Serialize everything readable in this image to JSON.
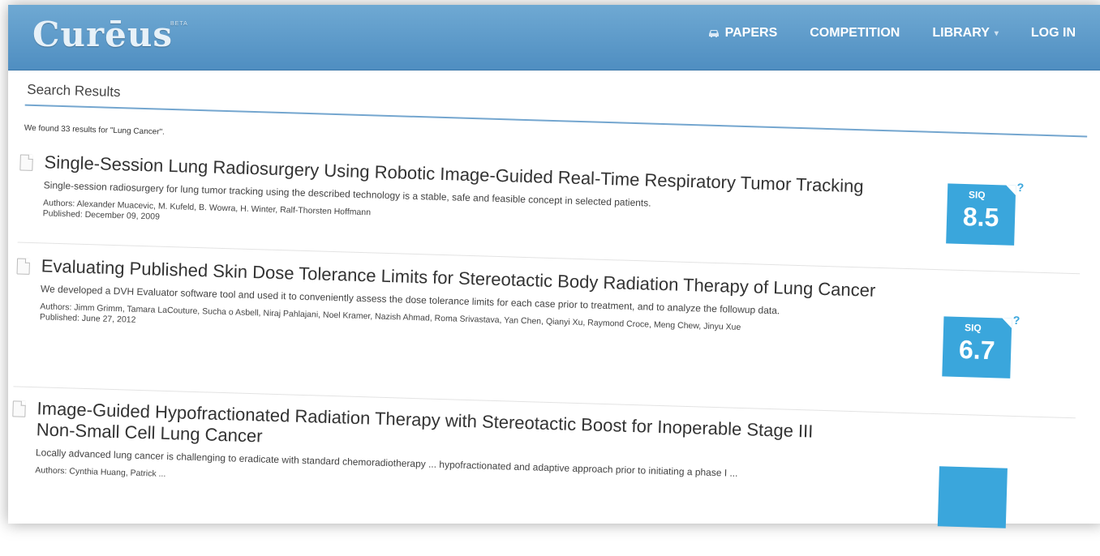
{
  "header": {
    "logo": "Curēus",
    "beta": "BETA",
    "nav": [
      {
        "label": "PAPERS",
        "icon": "car-icon"
      },
      {
        "label": "COMPETITION"
      },
      {
        "label": "LIBRARY",
        "dropdown": true
      },
      {
        "label": "LOG IN"
      }
    ]
  },
  "main": {
    "section_title": "Search Results",
    "found_text": "We found 33 results for \"Lung Cancer\".",
    "results": [
      {
        "title": "Single-Session Lung Radiosurgery Using Robotic Image-Guided Real-Time Respiratory Tumor Tracking",
        "summary": "Single-session radiosurgery for lung tumor tracking using the described technology is a stable, safe and feasible concept in selected patients.",
        "authors": "Authors: Alexander Muacevic, M. Kufeld, B. Wowra, H. Winter, Ralf-Thorsten Hoffmann",
        "published": "Published: December 09, 2009",
        "siq_label": "SIQ",
        "siq_score": "8.5"
      },
      {
        "title": "Evaluating Published Skin Dose Tolerance Limits for Stereotactic Body Radiation Therapy of Lung Cancer",
        "summary": "We developed a DVH Evaluator software tool and used it to conveniently assess the dose tolerance limits for each case prior to treatment, and to analyze the followup data.",
        "authors": "Authors: Jimm Grimm, Tamara LaCouture, Sucha o Asbell, Niraj Pahlajani, Noel Kramer, Nazish Ahmad, Roma Srivastava, Yan Chen, Qianyi Xu, Raymond Croce, Meng Chew, Jinyu Xue",
        "published": "Published: June 27, 2012",
        "siq_label": "SIQ",
        "siq_score": "6.7"
      },
      {
        "title": "Image-Guided Hypofractionated Radiation Therapy with Stereotactic Boost for Inoperable Stage III Non-Small Cell Lung Cancer",
        "summary": "Locally advanced lung cancer is challenging to eradicate with standard chemoradiotherapy ... hypofractionated and adaptive approach prior to initiating a phase I ...",
        "authors": "Authors: Cynthia Huang, Patrick ...",
        "published": ""
      }
    ],
    "siq_help": "?"
  },
  "colors": {
    "header": "#5b9aca",
    "siq_badge": "#3aa6dc",
    "rule": "#74a6cf"
  }
}
